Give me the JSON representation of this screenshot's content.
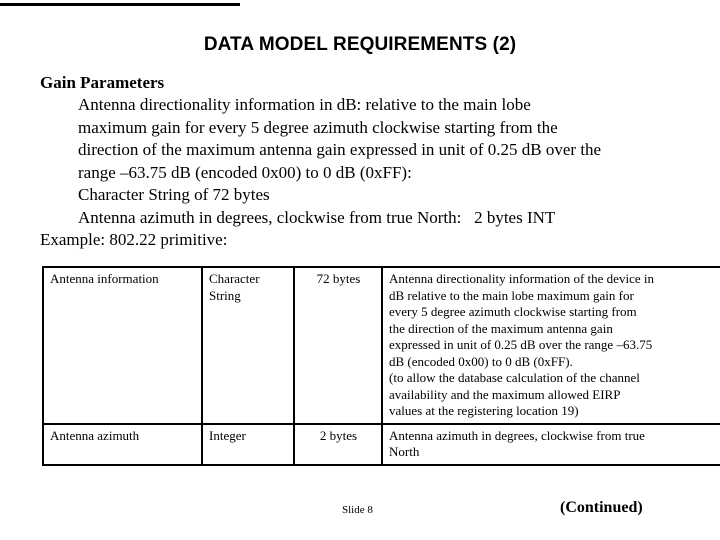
{
  "decoration": {
    "top_rule_color": "#000000"
  },
  "slide": {
    "title": "DATA MODEL REQUIREMENTS (2)",
    "section_heading": "Gain Parameters",
    "body_lines": [
      {
        "indent": true,
        "text": "Antenna directionality information in dB: relative to the main lobe"
      },
      {
        "indent": true,
        "text": "maximum gain for every 5 degree azimuth clockwise starting from the"
      },
      {
        "indent": true,
        "text": "direction of the maximum antenna gain expressed in unit of 0.25 dB over the"
      },
      {
        "indent": true,
        "text": "range –63.75 dB (encoded 0x00) to 0 dB (0xFF):"
      },
      {
        "indent": true,
        "text": "Character String of 72 bytes"
      },
      {
        "indent": true,
        "text": "Antenna azimuth in degrees, clockwise from true North:   2 bytes INT"
      },
      {
        "indent": false,
        "text": "Example: 802.22 primitive:"
      }
    ],
    "slide_number": "Slide 8",
    "continued_note": "(Continued)"
  },
  "table": {
    "rows": [
      {
        "name": "Antenna information",
        "type_lines": [
          "Character",
          "String"
        ],
        "size": "72 bytes",
        "description_lines": [
          "Antenna directionality information of the device in",
          "dB relative to the main lobe maximum gain for",
          "every 5 degree azimuth clockwise starting from",
          "the direction of the maximum antenna gain",
          "expressed in unit of 0.25 dB over the range –63.75",
          "dB (encoded 0x00) to 0 dB (0xFF).",
          "(to allow the database calculation of the channel",
          "availability and the maximum allowed EIRP",
          "values at the registering location 19)"
        ]
      },
      {
        "name": "Antenna azimuth",
        "type_lines": [
          "Integer"
        ],
        "size": "2 bytes",
        "description_lines": [
          "Antenna azimuth in degrees, clockwise from true",
          "North"
        ]
      }
    ]
  }
}
